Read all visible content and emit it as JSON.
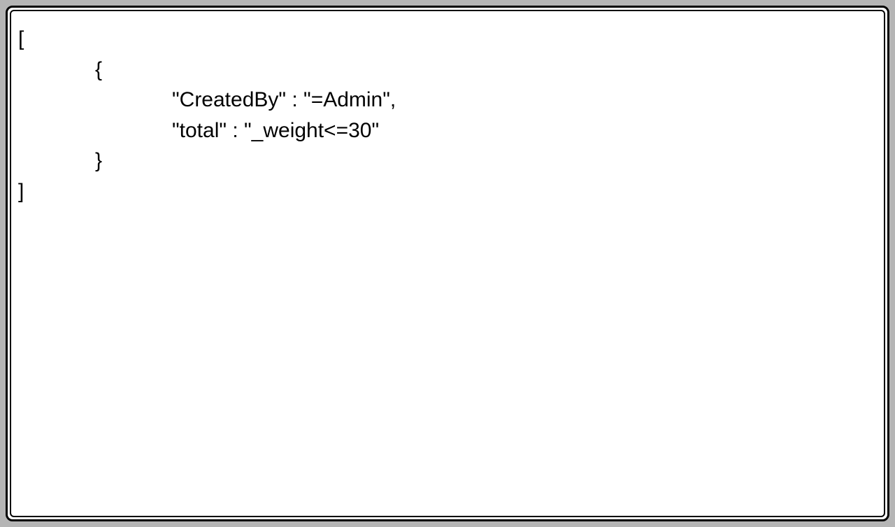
{
  "code": {
    "open_bracket": "[",
    "open_brace": "{",
    "line1": "\"CreatedBy\" : \"=Admin\",",
    "line2": "\"total\" : \"_weight<=30\"",
    "close_brace": "}",
    "close_bracket": "]"
  }
}
